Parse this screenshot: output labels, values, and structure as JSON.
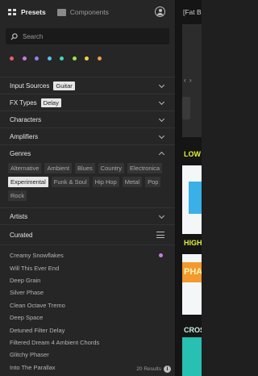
{
  "header": {
    "tabs": [
      {
        "label": "Presets",
        "icon": "grid-icon",
        "active": true
      },
      {
        "label": "Components",
        "icon": "components-icon",
        "active": false
      }
    ]
  },
  "search": {
    "placeholder": "Search"
  },
  "color_filters": [
    "#e95e6a",
    "#c77be0",
    "#8e83ee",
    "#4fc4f0",
    "#40d8b5",
    "#9fe14a",
    "#f0d33d",
    "#f59848"
  ],
  "filters": {
    "input_sources": {
      "label": "Input Sources",
      "value": "Guitar"
    },
    "fx_types": {
      "label": "FX Types",
      "value": "Delay"
    },
    "characters": {
      "label": "Characters"
    },
    "amplifiers": {
      "label": "Amplifiers"
    },
    "genres": {
      "label": "Genres",
      "options": [
        "Alternative",
        "Ambient",
        "Blues",
        "Country",
        "Electronica",
        "Experimental",
        "Funk & Soul",
        "Hip Hop",
        "Metal",
        "Pop",
        "Rock"
      ],
      "selected": "Experimental"
    },
    "artists": {
      "label": "Artists"
    }
  },
  "curated": {
    "label": "Curated",
    "items": [
      "Creamy Snowflakes",
      "Will This Ever End",
      "Deep Grain",
      "Silver Phase",
      "Clean Octave Tremo",
      "Deep Space",
      "Detuned Filter Delay",
      "Filtered Dream 4 Ambient Chords",
      "Glitchy Phaser",
      "Into The Parallax"
    ],
    "first_item_color": "#c77be0"
  },
  "footer": {
    "results": "20 Results"
  },
  "right_panel": {
    "title": "[Fat B",
    "labels": [
      "LOW",
      "HIGH",
      "PHA",
      "CROS"
    ],
    "label_colors": [
      "#e4ef3a",
      "#e4ef3a",
      "#e4ef3a",
      "#cfeee4"
    ],
    "accent_colors": [
      "#3ab0e8",
      "#f29a2e",
      "#27c0b2"
    ]
  }
}
